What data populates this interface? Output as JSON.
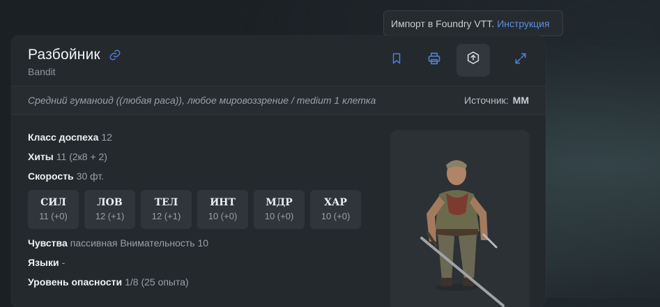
{
  "tooltip": {
    "text": "Импорт в Foundry VTT.",
    "link": "Инструкция"
  },
  "header": {
    "title": "Разбойник",
    "subtitle": "Bandit",
    "icons": [
      "link-icon",
      "bookmark-icon",
      "print-icon",
      "export-icon",
      "expand-icon"
    ]
  },
  "meta": {
    "description": "Средний гуманоид ((любая раса)), любое мировоззрение / medium 1 клетка",
    "source_label": "Источник:",
    "source_value": "MM"
  },
  "props": {
    "ac_label": "Класс доспеха",
    "ac_value": "12",
    "hp_label": "Хиты",
    "hp_value": "11 (2к8 + 2)",
    "speed_label": "Скорость",
    "speed_value": "30 фт."
  },
  "abilities": [
    {
      "name": "СИЛ",
      "value": "11 (+0)"
    },
    {
      "name": "ЛОВ",
      "value": "12 (+1)"
    },
    {
      "name": "ТЕЛ",
      "value": "12 (+1)"
    },
    {
      "name": "ИНТ",
      "value": "10 (+0)"
    },
    {
      "name": "МДР",
      "value": "10 (+0)"
    },
    {
      "name": "ХАР",
      "value": "10 (+0)"
    }
  ],
  "extra": {
    "senses_label": "Чувства",
    "senses_value": "пассивная Внимательность 10",
    "lang_label": "Языки",
    "lang_value": "-",
    "cr_label": "Уровень опасности",
    "cr_value": "1/8 (25 опыта)"
  },
  "colors": {
    "accent": "#4f7fd8",
    "card": "#24292e",
    "background": "#1b2024"
  }
}
